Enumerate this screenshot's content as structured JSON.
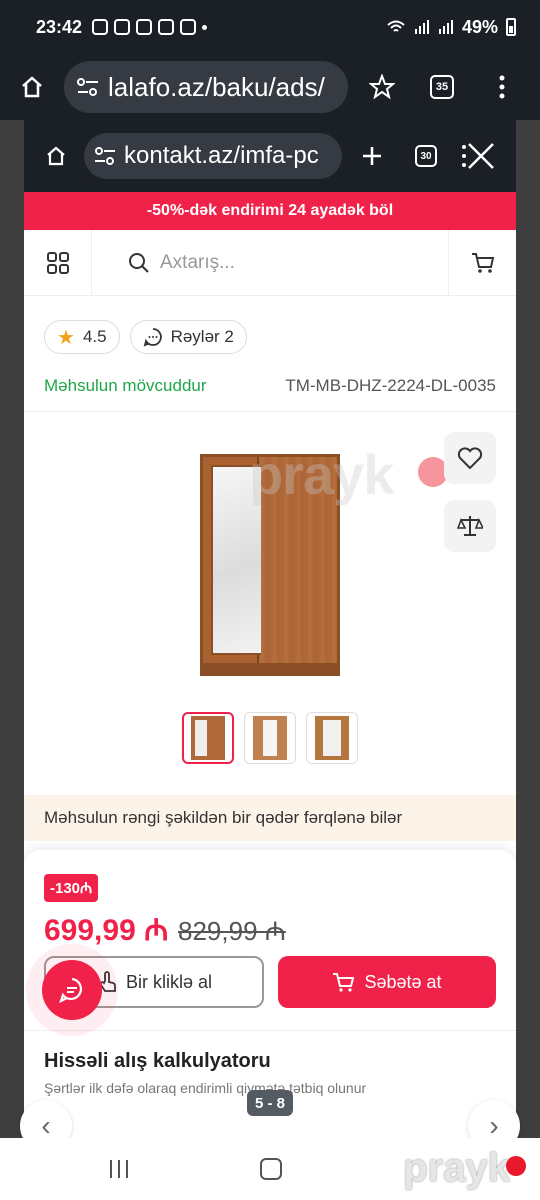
{
  "status_bar": {
    "time": "23:42",
    "battery": "49%"
  },
  "outer_browser": {
    "url": "lalafo.az/baku/ads/",
    "tab_count": "35"
  },
  "inner_browser": {
    "url": "kontakt.az/imfa-pc",
    "tab_count": "30"
  },
  "promo_banner": "-50%-dək endirimi  24 ayadək böl",
  "search": {
    "placeholder": "Axtarış..."
  },
  "product": {
    "rating": "4.5",
    "reviews_label": "Rəylər 2",
    "availability": "Məhsulun mövcuddur",
    "sku": "TM-MB-DHZ-2224-DL-0035",
    "color_note": "Məhsulun rəngi şəkildən bir qədər fərqlənə bilər",
    "discount_badge": "-130₼",
    "price_current": "699,99 ₼",
    "price_old": "829,99 ₼",
    "buy_one_click_label": "Bir kliklə al",
    "add_to_cart_label": "Səbətə at",
    "installment_title": "Hissəli alış kalkulyatoru",
    "installment_subtitle": "Şərtlər ilk dəfə olaraq endirimli qiymətə tətbiq olunur"
  },
  "watermark": "prayk",
  "gallery": {
    "page_indicator": "5 - 8"
  },
  "colors": {
    "brand_red": "#f0224a",
    "available_green": "#1fa64a",
    "dark_bar": "#1b1f26"
  },
  "icons": [
    "home-icon",
    "tune-icon",
    "star-icon",
    "tabs-icon",
    "more-icon",
    "plus-icon",
    "close-icon",
    "grid-icon",
    "search-icon",
    "cart-icon",
    "heart-icon",
    "compare-icon",
    "chat-icon",
    "touch-icon"
  ]
}
